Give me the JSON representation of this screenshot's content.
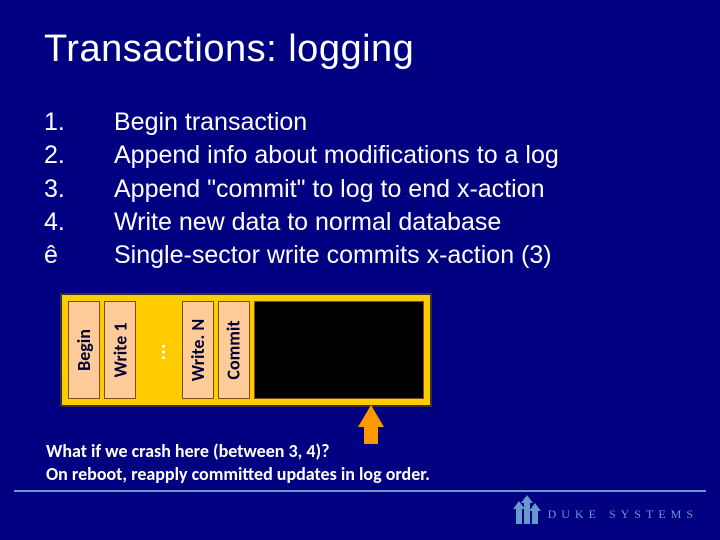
{
  "title": "Transactions: logging",
  "list": [
    {
      "num": "1.",
      "text": "Begin transaction"
    },
    {
      "num": "2.",
      "text": "Append info about modifications to a log"
    },
    {
      "num": "3.",
      "text": "Append \"commit\" to log to end x-action"
    },
    {
      "num": "4.",
      "text": "Write new data to normal database"
    },
    {
      "num": "ê",
      "text": "Single-sector write commits x-action (3)"
    }
  ],
  "log_labels": {
    "begin": "Begin",
    "write1": "Write 1",
    "ellipsis": "…",
    "writeN": "Write. N",
    "commit": "Commit"
  },
  "caption": {
    "line1": "What if we crash here (between 3, 4)?",
    "line2": "On reboot, reapply committed updates in log order."
  },
  "footer_brand": "Duke Systems"
}
